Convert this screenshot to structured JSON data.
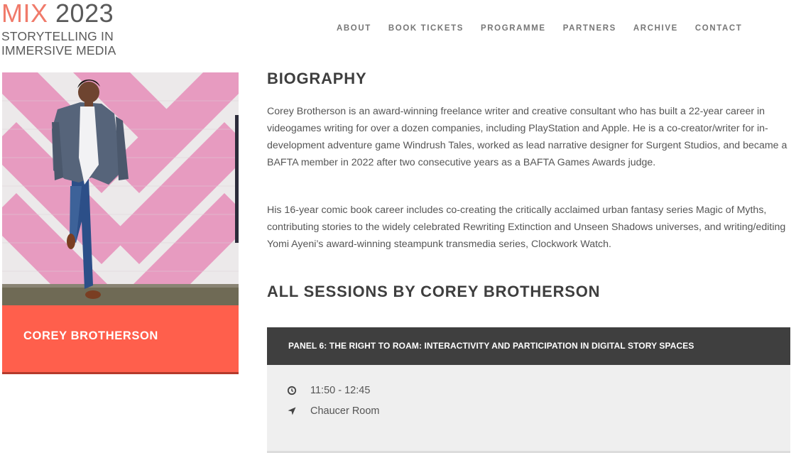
{
  "logo": {
    "mix": "MIX",
    "year": "2023",
    "line2": "STORYTELLING IN",
    "line3": "IMMERSIVE MEDIA"
  },
  "nav": [
    {
      "label": "ABOUT"
    },
    {
      "label": "BOOK TICKETS"
    },
    {
      "label": "PROGRAMME"
    },
    {
      "label": "PARTNERS"
    },
    {
      "label": "ARCHIVE"
    },
    {
      "label": "CONTACT"
    }
  ],
  "speaker": {
    "name": "COREY BROTHERSON"
  },
  "biography": {
    "heading": "BIOGRAPHY",
    "paragraphs": [
      "Corey Brotherson is an award-winning freelance writer and creative consultant who has built a 22-year career in videogames writing for over a dozen companies, including PlayStation and Apple. He is a co-creator/writer for in-development adventure game Windrush Tales, worked as lead narrative designer for Surgent Studios, and became a BAFTA member in 2022 after two consecutive years as a BAFTA Games Awards judge.",
      "His 16-year comic book career includes co-creating the critically acclaimed urban fantasy series Magic of Myths, contributing stories to the widely celebrated Rewriting Extinction and Unseen Shadows universes, and writing/editing Yomi Ayeni’s award-winning steampunk transmedia series, Clockwork Watch."
    ]
  },
  "sessions": {
    "heading": "ALL SESSIONS BY COREY BROTHERSON",
    "items": [
      {
        "title": "PANEL 6: THE RIGHT TO ROAM: INTERACTIVITY AND PARTICIPATION IN DIGITAL STORY SPACES",
        "time": "11:50 - 12:45",
        "location": "Chaucer Room"
      }
    ]
  },
  "colors": {
    "accent": "#ff5f4c",
    "logo_accent": "#f07a6a",
    "session_header": "#3f3f3f",
    "session_body": "#efefef"
  },
  "icons": {
    "time": "clock-icon",
    "location": "location-arrow-icon"
  }
}
